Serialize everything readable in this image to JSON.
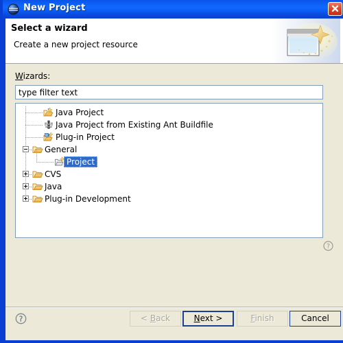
{
  "window": {
    "title": "New Project",
    "title_icon": "eclipse-sphere-icon",
    "close_label": "Close",
    "border_color": "#0a3fd4",
    "titlebar_color": "#1168ff"
  },
  "header": {
    "title": "Select a wizard",
    "description": "Create a new project resource",
    "banner_icon": "new-window-sparkle-icon"
  },
  "form": {
    "wizards_label_prefix": "W",
    "wizards_label_rest": "izards:",
    "filter": {
      "value": "type filter text",
      "placeholder": "type filter text"
    }
  },
  "tree": {
    "help_icon": "help-question-icon",
    "selection_color": "#316ac5",
    "items": [
      {
        "label": "Java Project",
        "icon": "java-project-icon",
        "indent": 1,
        "twisty": "none",
        "selected": false
      },
      {
        "label": "Java Project from Existing Ant Buildfile",
        "icon": "ant-buildfile-icon",
        "indent": 1,
        "twisty": "none",
        "selected": false
      },
      {
        "label": "Plug-in Project",
        "icon": "plugin-project-icon",
        "indent": 1,
        "twisty": "none",
        "selected": false
      },
      {
        "label": "General",
        "icon": "folder-open-icon",
        "indent": 0,
        "twisty": "expanded",
        "selected": false
      },
      {
        "label": "Project",
        "icon": "new-project-icon",
        "indent": 2,
        "twisty": "none",
        "selected": true
      },
      {
        "label": "CVS",
        "icon": "folder-open-icon",
        "indent": 0,
        "twisty": "collapsed",
        "selected": false
      },
      {
        "label": "Java",
        "icon": "folder-open-icon",
        "indent": 0,
        "twisty": "collapsed",
        "selected": false
      },
      {
        "label": "Plug-in Development",
        "icon": "folder-open-icon",
        "indent": 0,
        "twisty": "collapsed",
        "selected": false
      }
    ]
  },
  "buttons": {
    "help_icon": "help-question-icon",
    "back": {
      "prefix": "< ",
      "mnemonic": "B",
      "suffix": "ack",
      "enabled": false,
      "default": false
    },
    "next": {
      "prefix": "",
      "mnemonic": "N",
      "suffix": "ext >",
      "enabled": true,
      "default": true
    },
    "finish": {
      "prefix": "",
      "mnemonic": "F",
      "suffix": "inish",
      "enabled": false,
      "default": false
    },
    "cancel": {
      "prefix": "",
      "mnemonic": "",
      "suffix": "Cancel",
      "enabled": true,
      "default": false
    }
  }
}
